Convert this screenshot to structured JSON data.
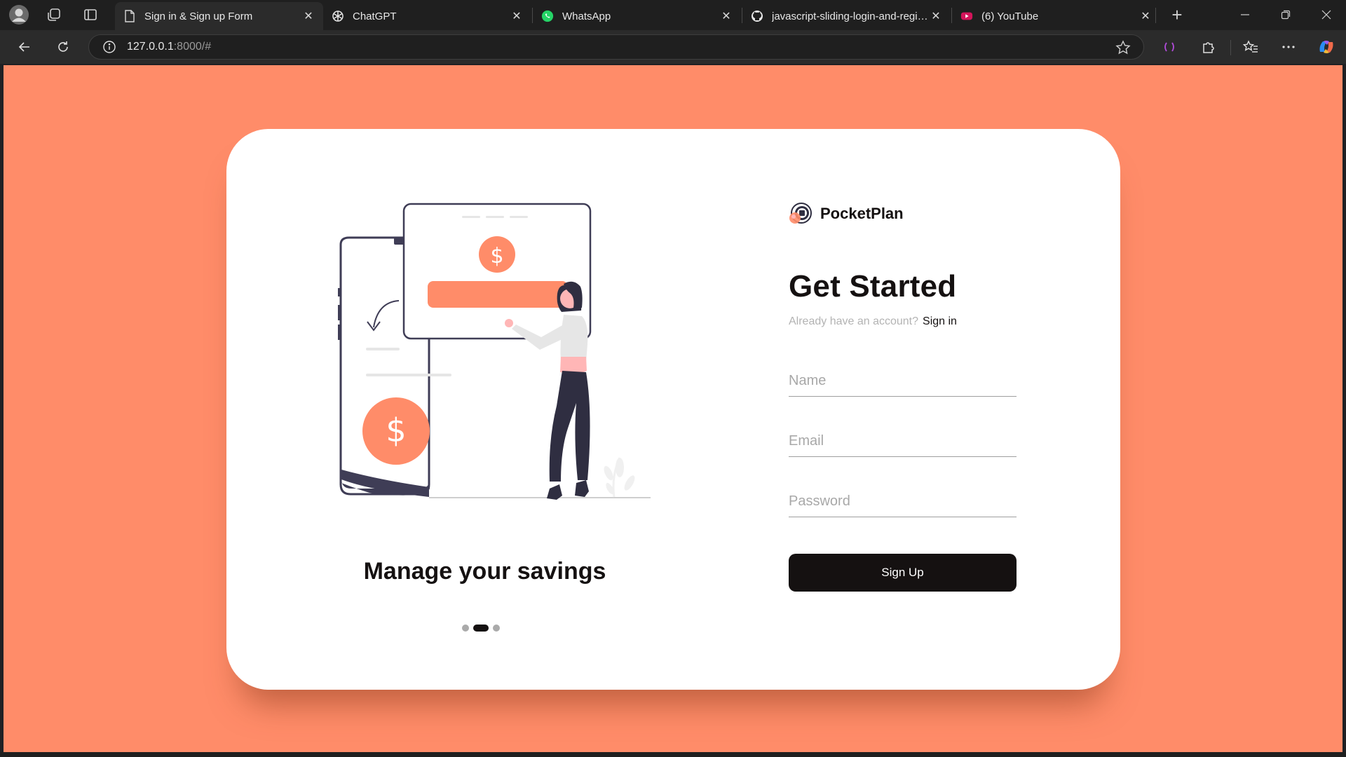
{
  "browser": {
    "tabs": [
      {
        "title": "Sign in & Sign up Form",
        "icon": "page-icon",
        "active": true
      },
      {
        "title": "ChatGPT",
        "icon": "chatgpt-icon",
        "active": false
      },
      {
        "title": "WhatsApp",
        "icon": "whatsapp-icon",
        "active": false
      },
      {
        "title": "javascript-sliding-login-and-registration",
        "icon": "github-icon",
        "active": false
      },
      {
        "title": "(6) YouTube",
        "icon": "youtube-icon",
        "active": false
      }
    ],
    "url_host": "127.0.0.1",
    "url_path": ":8000/#"
  },
  "page": {
    "background": "#ff8c69",
    "accent": "#ff8c69",
    "carousel": {
      "text": "Manage your savings",
      "slides": 3,
      "active_index": 1
    },
    "brand": {
      "name": "PocketPlan"
    },
    "heading": "Get Started",
    "switch_prompt": "Already have an account?",
    "switch_link": "Sign in",
    "form": {
      "name_placeholder": "Name",
      "email_placeholder": "Email",
      "password_placeholder": "Password",
      "submit_label": "Sign Up"
    }
  }
}
